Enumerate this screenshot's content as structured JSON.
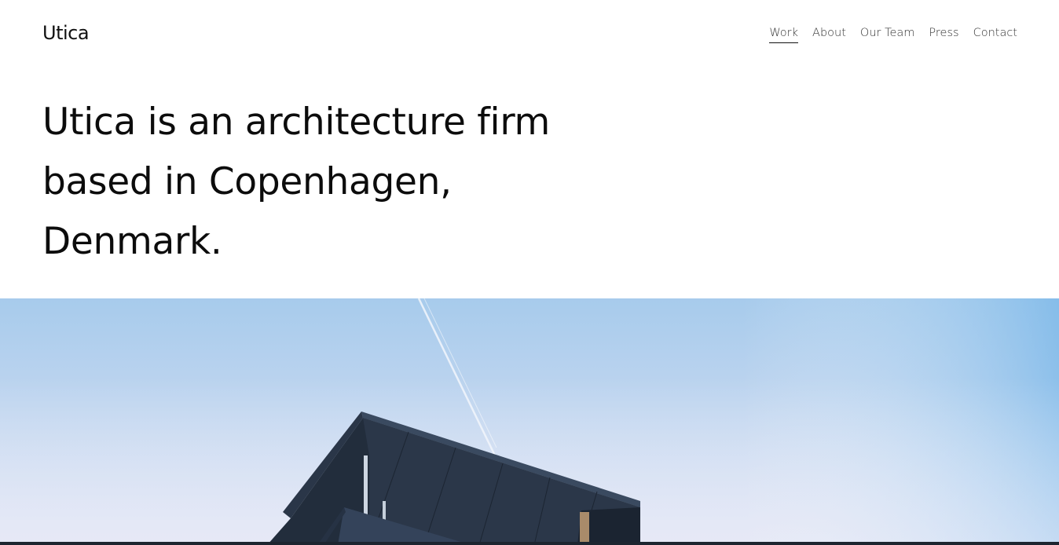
{
  "site": {
    "logo": "Utica"
  },
  "nav": {
    "items": [
      {
        "label": "Work",
        "active": true
      },
      {
        "label": "About",
        "active": false
      },
      {
        "label": "Our Team",
        "active": false
      },
      {
        "label": "Press",
        "active": false
      },
      {
        "label": "Contact",
        "active": false
      }
    ]
  },
  "hero": {
    "headline": "Utica is an architecture firm based in Copenhagen, Denmark."
  },
  "colors": {
    "sky_top": "#9ec6ea",
    "sky_bottom": "#dfe3f3",
    "building_dark": "#1e2a3a",
    "building_mid": "#2d3a4d",
    "text": "#111111"
  }
}
